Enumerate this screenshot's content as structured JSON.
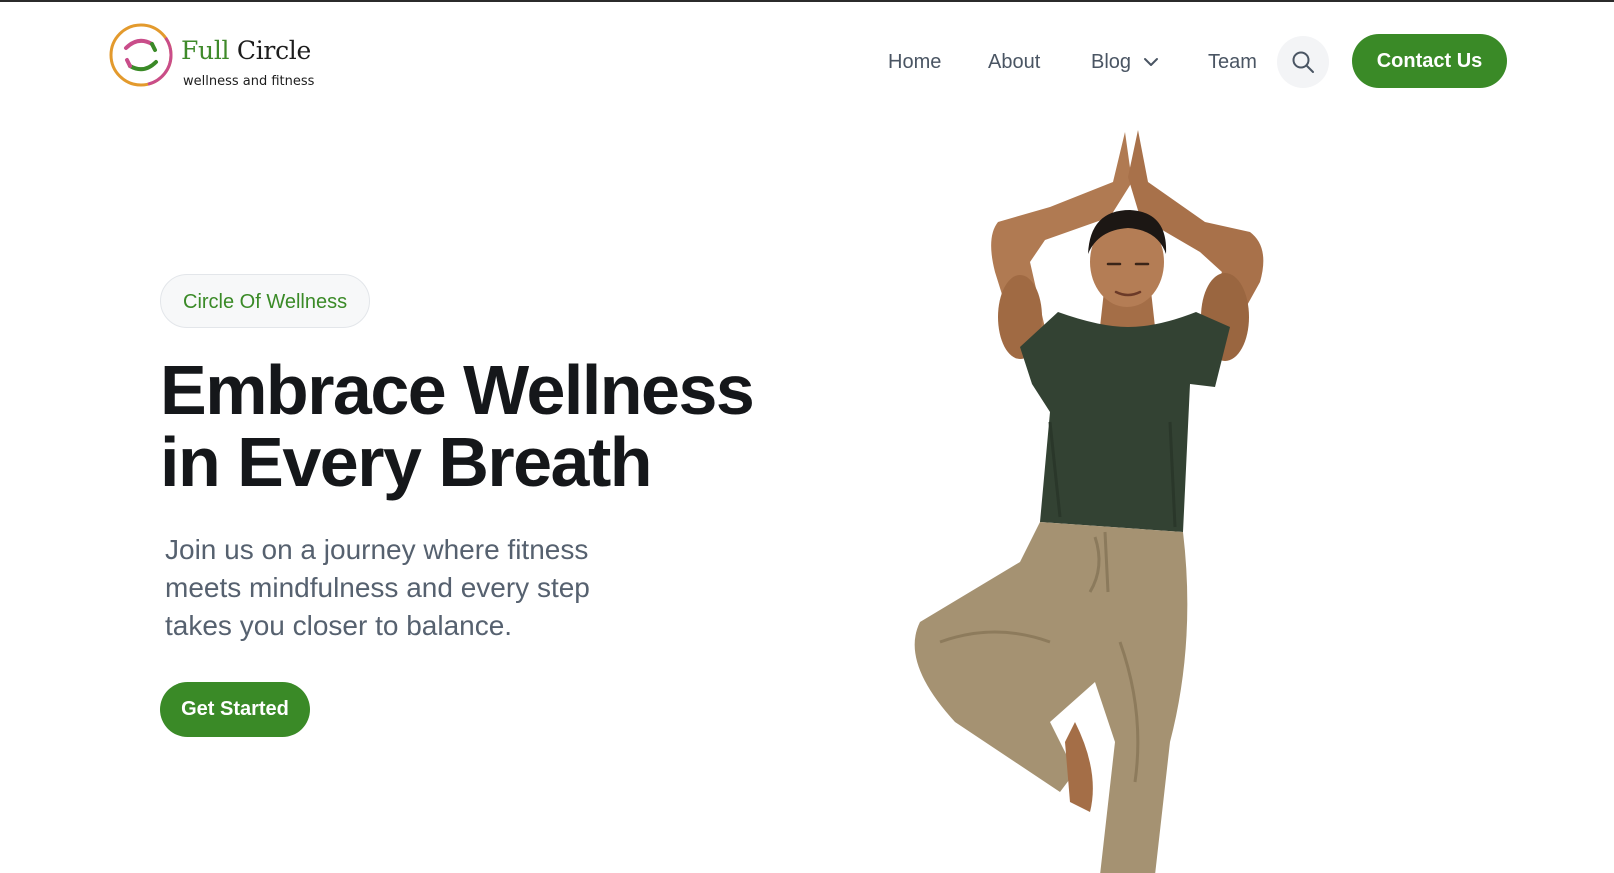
{
  "brand": {
    "name_part1": "Full",
    "name_part2": "Circle",
    "tagline": "wellness and fitness",
    "colors": {
      "green": "#3a8a27",
      "pink": "#c94d8a",
      "orange": "#e39a2d"
    },
    "icon": "circle-logo-icon"
  },
  "nav": {
    "items": [
      {
        "label": "Home"
      },
      {
        "label": "About"
      },
      {
        "label": "Blog",
        "has_dropdown": true,
        "icon": "chevron-down-icon"
      },
      {
        "label": "Team"
      }
    ],
    "search_icon": "search-icon",
    "contact_label": "Contact Us"
  },
  "hero": {
    "eyebrow": "Circle Of Wellness",
    "headline_lines": [
      "Embrace Wellness",
      "in Every Breath"
    ],
    "lede_lines": [
      "Join us on a journey where fitness",
      "meets mindfulness and every step",
      "takes you closer to balance."
    ],
    "cta_label": "Get Started",
    "image_subject": "man in tree pose with hands pressed overhead"
  },
  "theme": {
    "accent": "#3a8a27",
    "heading": "#15171a",
    "body_text": "#56616f",
    "nav_text": "#4a5563",
    "background": "#ffffff"
  }
}
